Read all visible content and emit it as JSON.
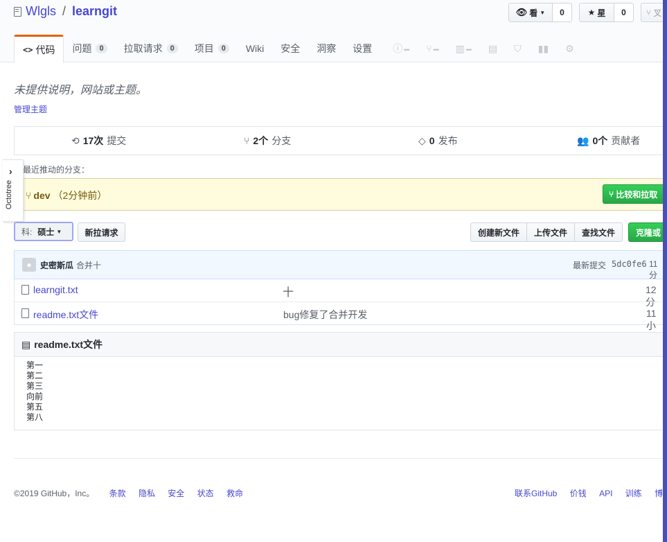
{
  "header": {
    "owner": "Wlgls",
    "separator": "/",
    "repo": "learngit",
    "watch_label": "看",
    "watch_count": "0",
    "star_label": "星",
    "star_count": "0",
    "fork_label": "叉"
  },
  "tabs": [
    {
      "label": "代码",
      "icon": "code-icon"
    },
    {
      "label": "问题",
      "count": "0"
    },
    {
      "label": "拉取请求",
      "count": "0"
    },
    {
      "label": "项目",
      "count": "0"
    },
    {
      "label": "Wiki"
    },
    {
      "label": "安全"
    },
    {
      "label": "洞察"
    },
    {
      "label": "设置"
    }
  ],
  "description": "未提供说明，网站或主题。",
  "manage_topics": "管理主题",
  "summary": {
    "commits_num": "17次",
    "commits_label": "提交",
    "branches_num": "2个",
    "branches_label": "分支",
    "releases_num": "0",
    "releases_label": "发布",
    "contributors_num": "0个",
    "contributors_label": "贡献者"
  },
  "recent": {
    "label": "最近推动的分支：",
    "branch": "dev",
    "time": "（2分钟前）",
    "compare_button": "比较和拉取"
  },
  "octotree": {
    "label": "Octotree"
  },
  "toolbar": {
    "branch_prefix": "科:",
    "branch_name": "硕士",
    "new_pr": "新拉请求",
    "create_file": "创建新文件",
    "upload_files": "上传文件",
    "find_file": "查找文件",
    "clone": "克隆或"
  },
  "latest_commit": {
    "author": "史密斯瓜",
    "message": "合并十",
    "label": "最新提交",
    "hash": "5dc0fe6",
    "time": "11分"
  },
  "files": [
    {
      "name": "learngit.txt",
      "message": "十",
      "time": "12分"
    },
    {
      "name": "readme.txt文件",
      "message": "bug修复了合并开发",
      "time": "11小"
    }
  ],
  "readme": {
    "title": "readme.txt文件",
    "lines": [
      "第一",
      "第二",
      "第三",
      "向前",
      "第五",
      "第八"
    ]
  },
  "footer": {
    "copyright": "©2019 GitHub，Inc。",
    "left_links": [
      "条款",
      "隐私",
      "安全",
      "状态",
      "救命"
    ],
    "right_links": [
      "联系GitHub",
      "价钱",
      "API",
      "训练",
      "博客"
    ]
  },
  "colors": {
    "link": "#4747d1",
    "green": "#28a745",
    "tab_accent": "#e36209",
    "recent_bg": "#fffbdd",
    "right_bar": "#4a4fb0"
  }
}
